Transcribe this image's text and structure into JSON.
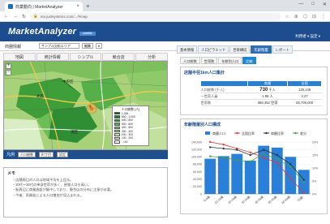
{
  "browser": {
    "tab_title": "商業動向 | MarketAnalyzer",
    "url": "ma.justsystems.com/.../#map",
    "controls": [
      "—",
      "□",
      "✕"
    ],
    "ext_icons": [
      "☆",
      "⊕",
      "⬡",
      "⊟",
      "⋮"
    ]
  },
  "app": {
    "logo": "MarketAnalyzer",
    "logo_badge": "satellite",
    "user": "利用者 ▾ 設定 ▾"
  },
  "subbar": {
    "label": "商圏情報",
    "select_value": "サンプル分析エリア",
    "btn1": "編集",
    "btn2": "▾"
  },
  "map_tabs": [
    "地図",
    "統計情報",
    "シンプル",
    "競合店",
    "分析"
  ],
  "map_legend": {
    "title": "人口総数 (人)",
    "rows": [
      {
        "label": "1,000 -",
        "color": "#0b5b1e"
      },
      {
        "label": "800 - 1,000",
        "color": "#1a7f2a"
      },
      {
        "label": "600 - 800",
        "color": "#2f9c3a"
      },
      {
        "label": "500 - 600",
        "color": "#56b54c"
      },
      {
        "label": "400 - 500",
        "color": "#7bc866"
      },
      {
        "label": "300 - 400",
        "color": "#a3d98a"
      },
      {
        "label": "200 - 300",
        "color": "#c6e8ae"
      },
      {
        "label": "100 - 200",
        "color": "#e2f3d3"
      },
      {
        "label": "- 100",
        "color": "#ffffff"
      }
    ]
  },
  "map_labels": {
    "city1": "中央区",
    "city2": "北区",
    "city3": "港区"
  },
  "map_bar": {
    "label": "凡例",
    "select1": "人口総数",
    "select2": "町丁目",
    "btn": "設定"
  },
  "memo": {
    "title": "メモ",
    "lines": [
      "・店舗周辺の人口は地域平均を上回る。",
      "・20代〜30代の単身世帯が多く、昼間人口も高い。",
      "・駅周辺に商業施設が集中しており、競合店の分布に注意が必要。",
      "・今後、再開発による人口増加が見込まれる。"
    ]
  },
  "right_tabs": [
    {
      "label": "基本情報",
      "active": false
    },
    {
      "label": "人口ピラミッド",
      "active": false
    },
    {
      "label": "世帯構成",
      "active": false
    },
    {
      "label": "年齢階層",
      "active": true
    },
    {
      "label": "レポート",
      "active": false
    }
  ],
  "right_subtabs": [
    {
      "label": "人口総数",
      "active": false
    },
    {
      "label": "世帯数",
      "active": false
    },
    {
      "label": "年齢別人口",
      "active": false
    },
    {
      "label": "比較",
      "active": true
    }
  ],
  "panel1": {
    "title": "店舗半径1km人口集計",
    "headers": [
      "",
      "商圏",
      "全国"
    ],
    "rows": [
      {
        "label": "人口総数 (千人)",
        "v1": "730",
        "v1_unit": "千人",
        "v2": "126,146"
      },
      {
        "label": "一世帯人員",
        "v1": "1.98",
        "v1_unit": "人",
        "v2": "2.27"
      },
      {
        "label": "世帯数",
        "v1": "368,452",
        "v1_unit": "世帯",
        "v2": "55,705,000"
      }
    ]
  },
  "panel2": {
    "title": "年齢階層別人口構成",
    "legend": [
      "商圏人口",
      "全国比率",
      "商圏比率",
      "差分"
    ]
  },
  "chart_data": {
    "type": "bar",
    "categories": [
      "0-9歳",
      "10-19歳",
      "20-29歳",
      "30-39歳",
      "40-49歳",
      "50-59歳",
      "60-69歳",
      "70歳-"
    ],
    "series": [
      {
        "name": "商圏人口",
        "type": "bar",
        "values": [
          95000,
          102000,
          108000,
          90000,
          130000,
          125000,
          100000,
          65000
        ],
        "color": "#2a7fd8"
      },
      {
        "name": "全国比率",
        "type": "line",
        "values": [
          20.0,
          19.0,
          17.5,
          16.0,
          14.0,
          12.0,
          6.0,
          0.5
        ],
        "color": "#e53935"
      },
      {
        "name": "商圏比率",
        "type": "line",
        "values": [
          18.0,
          17.5,
          17.0,
          15.0,
          17.0,
          15.0,
          11.5,
          5.5
        ],
        "color": "#263238"
      },
      {
        "name": "差分",
        "type": "line",
        "values": [
          14.5,
          14.0,
          13.0,
          12.5,
          15.5,
          13.5,
          10.5,
          4.5
        ],
        "color": "#43a047"
      }
    ],
    "y_left": {
      "min": 0,
      "max": 140000,
      "ticks": [
        "0",
        "20,000",
        "40,000",
        "60,000",
        "80,000",
        "100,000",
        "120,000",
        "140,000"
      ]
    },
    "y_right": {
      "min": 0,
      "max": 20,
      "ticks": [
        "0%",
        "5%",
        "10%",
        "15%",
        "20%"
      ]
    },
    "grid": true,
    "legend_position": "top"
  }
}
